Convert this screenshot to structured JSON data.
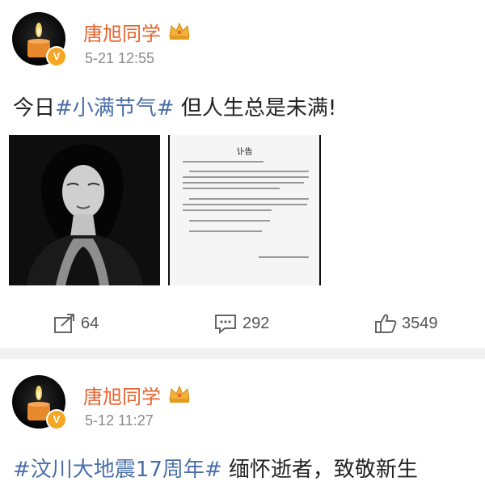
{
  "posts": [
    {
      "username": "唐旭同学",
      "timestamp": "5-21 12:55",
      "text_prefix": "今日",
      "hashtag": "#小满节气#",
      "text_suffix": " 但人生总是未满!",
      "images": [
        {
          "type": "portrait-photo",
          "icon": "portrait-photo"
        },
        {
          "type": "notice-document",
          "title": "讣告"
        }
      ],
      "actions": {
        "share_count": "64",
        "comment_count": "292",
        "like_count": "3549"
      }
    },
    {
      "username": "唐旭同学",
      "timestamp": "5-12 11:27",
      "hashtag": "#汶川大地震17周年#",
      "text_suffix": " 缅怀逝者，致敬新生"
    }
  ],
  "colors": {
    "username": "#e8632e",
    "hashtag": "#4a6fa8",
    "timestamp": "#8a8a8a",
    "badge": "#f5a623",
    "separator": "#f1f1f1"
  }
}
